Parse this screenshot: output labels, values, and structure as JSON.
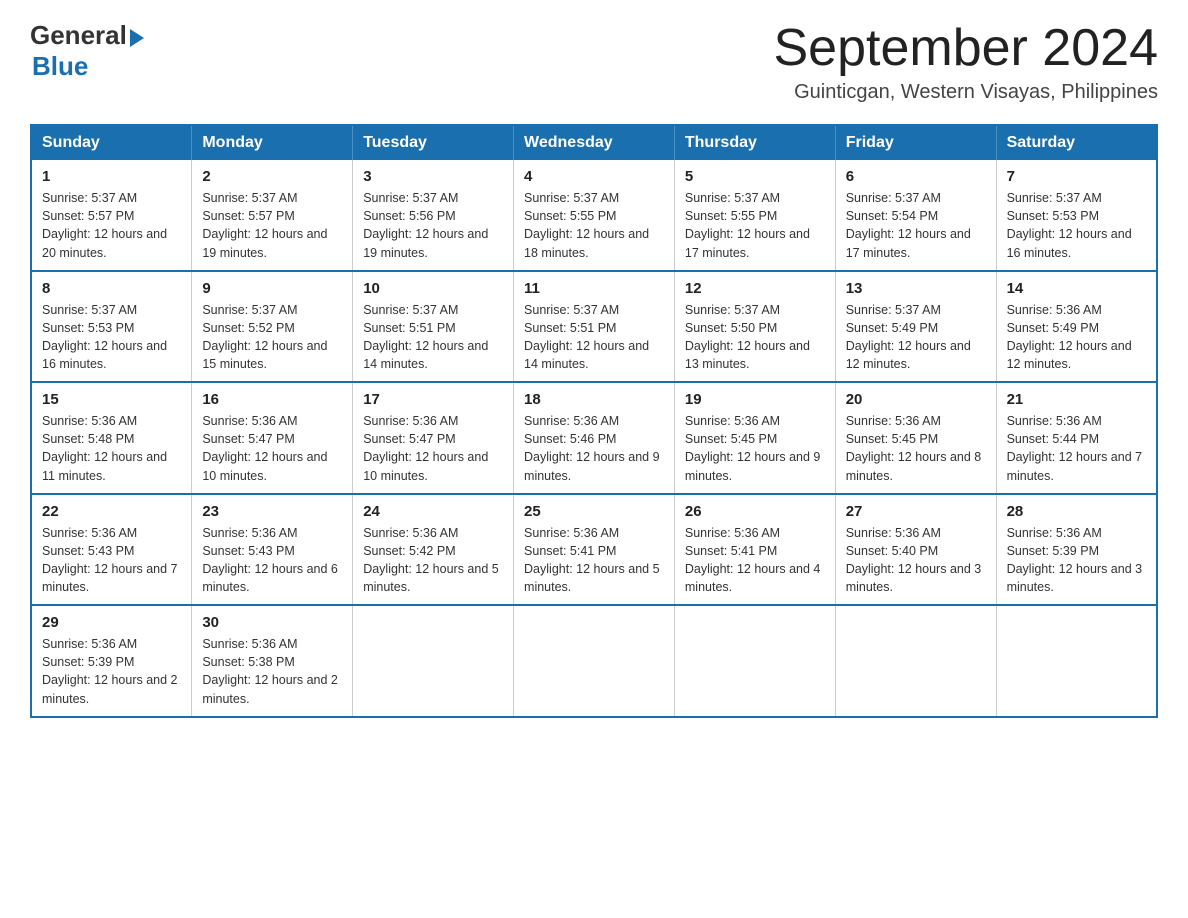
{
  "header": {
    "logo_general": "General",
    "logo_blue": "Blue",
    "month_title": "September 2024",
    "location": "Guinticgan, Western Visayas, Philippines"
  },
  "weekdays": [
    "Sunday",
    "Monday",
    "Tuesday",
    "Wednesday",
    "Thursday",
    "Friday",
    "Saturday"
  ],
  "weeks": [
    [
      {
        "day": "1",
        "sunrise": "5:37 AM",
        "sunset": "5:57 PM",
        "daylight": "12 hours and 20 minutes."
      },
      {
        "day": "2",
        "sunrise": "5:37 AM",
        "sunset": "5:57 PM",
        "daylight": "12 hours and 19 minutes."
      },
      {
        "day": "3",
        "sunrise": "5:37 AM",
        "sunset": "5:56 PM",
        "daylight": "12 hours and 19 minutes."
      },
      {
        "day": "4",
        "sunrise": "5:37 AM",
        "sunset": "5:55 PM",
        "daylight": "12 hours and 18 minutes."
      },
      {
        "day": "5",
        "sunrise": "5:37 AM",
        "sunset": "5:55 PM",
        "daylight": "12 hours and 17 minutes."
      },
      {
        "day": "6",
        "sunrise": "5:37 AM",
        "sunset": "5:54 PM",
        "daylight": "12 hours and 17 minutes."
      },
      {
        "day": "7",
        "sunrise": "5:37 AM",
        "sunset": "5:53 PM",
        "daylight": "12 hours and 16 minutes."
      }
    ],
    [
      {
        "day": "8",
        "sunrise": "5:37 AM",
        "sunset": "5:53 PM",
        "daylight": "12 hours and 16 minutes."
      },
      {
        "day": "9",
        "sunrise": "5:37 AM",
        "sunset": "5:52 PM",
        "daylight": "12 hours and 15 minutes."
      },
      {
        "day": "10",
        "sunrise": "5:37 AM",
        "sunset": "5:51 PM",
        "daylight": "12 hours and 14 minutes."
      },
      {
        "day": "11",
        "sunrise": "5:37 AM",
        "sunset": "5:51 PM",
        "daylight": "12 hours and 14 minutes."
      },
      {
        "day": "12",
        "sunrise": "5:37 AM",
        "sunset": "5:50 PM",
        "daylight": "12 hours and 13 minutes."
      },
      {
        "day": "13",
        "sunrise": "5:37 AM",
        "sunset": "5:49 PM",
        "daylight": "12 hours and 12 minutes."
      },
      {
        "day": "14",
        "sunrise": "5:36 AM",
        "sunset": "5:49 PM",
        "daylight": "12 hours and 12 minutes."
      }
    ],
    [
      {
        "day": "15",
        "sunrise": "5:36 AM",
        "sunset": "5:48 PM",
        "daylight": "12 hours and 11 minutes."
      },
      {
        "day": "16",
        "sunrise": "5:36 AM",
        "sunset": "5:47 PM",
        "daylight": "12 hours and 10 minutes."
      },
      {
        "day": "17",
        "sunrise": "5:36 AM",
        "sunset": "5:47 PM",
        "daylight": "12 hours and 10 minutes."
      },
      {
        "day": "18",
        "sunrise": "5:36 AM",
        "sunset": "5:46 PM",
        "daylight": "12 hours and 9 minutes."
      },
      {
        "day": "19",
        "sunrise": "5:36 AM",
        "sunset": "5:45 PM",
        "daylight": "12 hours and 9 minutes."
      },
      {
        "day": "20",
        "sunrise": "5:36 AM",
        "sunset": "5:45 PM",
        "daylight": "12 hours and 8 minutes."
      },
      {
        "day": "21",
        "sunrise": "5:36 AM",
        "sunset": "5:44 PM",
        "daylight": "12 hours and 7 minutes."
      }
    ],
    [
      {
        "day": "22",
        "sunrise": "5:36 AM",
        "sunset": "5:43 PM",
        "daylight": "12 hours and 7 minutes."
      },
      {
        "day": "23",
        "sunrise": "5:36 AM",
        "sunset": "5:43 PM",
        "daylight": "12 hours and 6 minutes."
      },
      {
        "day": "24",
        "sunrise": "5:36 AM",
        "sunset": "5:42 PM",
        "daylight": "12 hours and 5 minutes."
      },
      {
        "day": "25",
        "sunrise": "5:36 AM",
        "sunset": "5:41 PM",
        "daylight": "12 hours and 5 minutes."
      },
      {
        "day": "26",
        "sunrise": "5:36 AM",
        "sunset": "5:41 PM",
        "daylight": "12 hours and 4 minutes."
      },
      {
        "day": "27",
        "sunrise": "5:36 AM",
        "sunset": "5:40 PM",
        "daylight": "12 hours and 3 minutes."
      },
      {
        "day": "28",
        "sunrise": "5:36 AM",
        "sunset": "5:39 PM",
        "daylight": "12 hours and 3 minutes."
      }
    ],
    [
      {
        "day": "29",
        "sunrise": "5:36 AM",
        "sunset": "5:39 PM",
        "daylight": "12 hours and 2 minutes."
      },
      {
        "day": "30",
        "sunrise": "5:36 AM",
        "sunset": "5:38 PM",
        "daylight": "12 hours and 2 minutes."
      },
      null,
      null,
      null,
      null,
      null
    ]
  ]
}
